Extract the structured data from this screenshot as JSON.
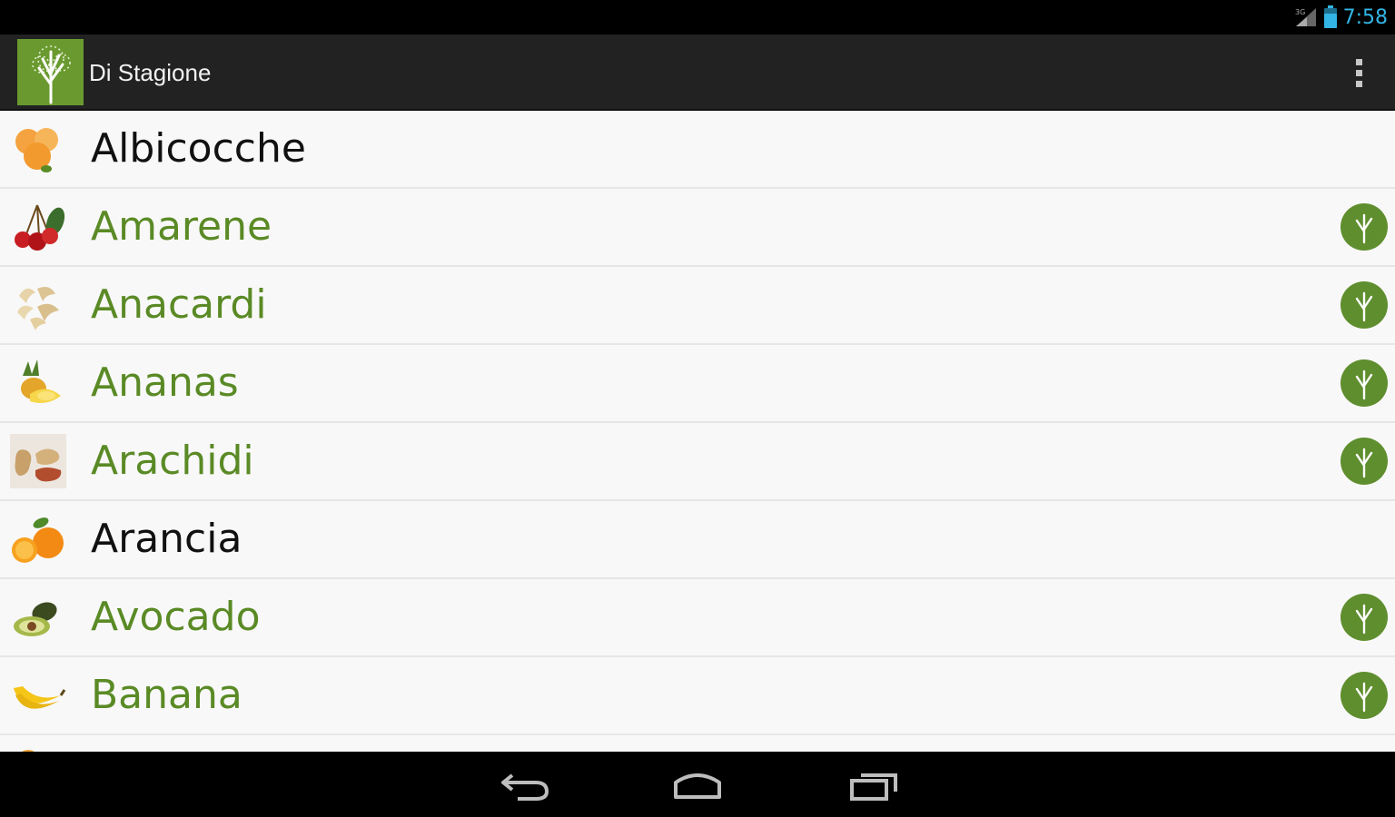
{
  "status_bar": {
    "time": "7:58",
    "signal_icon": "signal-icon",
    "battery_icon": "battery-icon"
  },
  "action_bar": {
    "title": "Di Stagione",
    "logo_icon": "tree-icon",
    "overflow_icon": "overflow-menu-icon"
  },
  "colors": {
    "accent": "#33b5e5",
    "green_text": "#5a8a25",
    "badge_green": "#5f8e2e",
    "action_bar_bg": "#222222"
  },
  "items": [
    {
      "label": "Albicocche",
      "icon": "apricot-icon",
      "badge": false
    },
    {
      "label": "Amarene",
      "icon": "cherry-icon",
      "badge": true
    },
    {
      "label": "Anacardi",
      "icon": "cashew-icon",
      "badge": true
    },
    {
      "label": "Ananas",
      "icon": "pineapple-icon",
      "badge": true
    },
    {
      "label": "Arachidi",
      "icon": "peanut-icon",
      "badge": true
    },
    {
      "label": "Arancia",
      "icon": "orange-icon",
      "badge": false
    },
    {
      "label": "Avocado",
      "icon": "avocado-icon",
      "badge": true
    },
    {
      "label": "Banana",
      "icon": "banana-icon",
      "badge": true
    }
  ],
  "nav_bar": {
    "back_icon": "back-icon",
    "home_icon": "home-icon",
    "recents_icon": "recents-icon"
  }
}
